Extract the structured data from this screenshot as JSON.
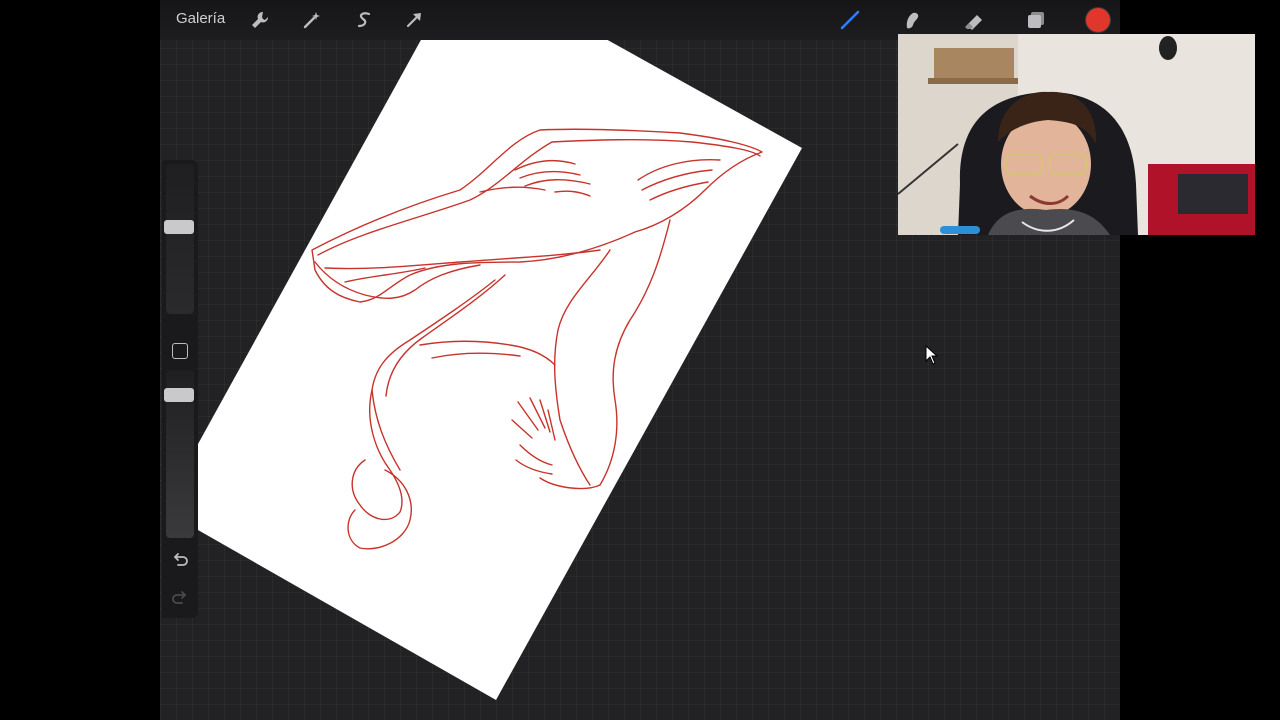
{
  "toolbar": {
    "gallery_label": "Galería",
    "left_tools": [
      "wrench-icon",
      "magic-wand-icon",
      "selection-icon",
      "transform-arrow-icon"
    ],
    "right_tools": [
      "brush-icon",
      "smudge-icon",
      "eraser-icon",
      "layers-icon"
    ],
    "active_tool": "brush-icon",
    "current_color": "#e0362c"
  },
  "sidebar": {
    "brush_size_slider": "size-slider",
    "opacity_slider": "opacity-slider",
    "buttons": [
      "modify-square-icon",
      "undo-icon",
      "redo-icon"
    ]
  },
  "canvas": {
    "stroke_color": "#c8332c",
    "paper_color": "#ffffff",
    "rotation_deg": 30,
    "content": "sketch-of-animal-head"
  },
  "webcam_overlay": {
    "present": true
  },
  "colors": {
    "app_background": "#222224",
    "topbar": "#1a1a1c",
    "active_tool_blue": "#2f7cf6"
  }
}
